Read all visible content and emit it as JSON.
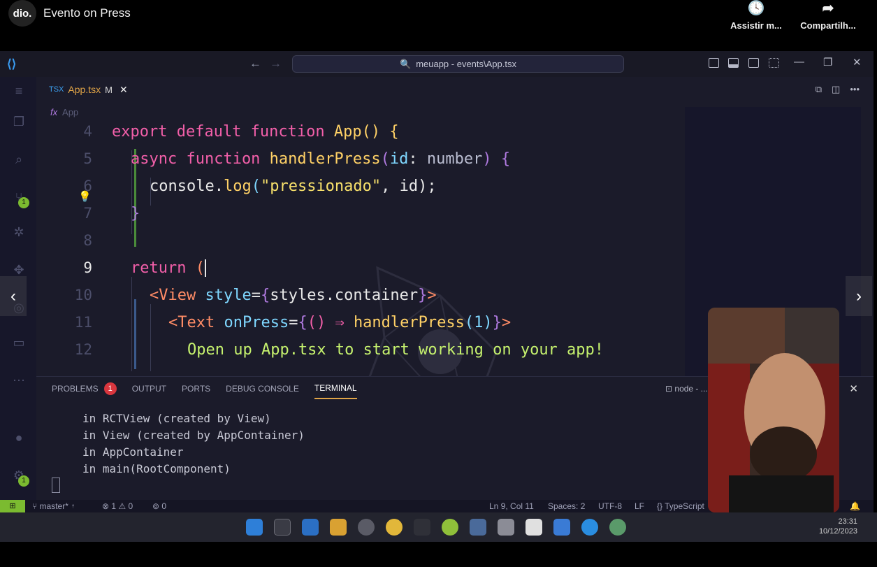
{
  "video": {
    "channel_logo": "dio.",
    "title": "Evento on Press",
    "actions": [
      {
        "icon": "clock-icon",
        "label": "Assistir m..."
      },
      {
        "icon": "share-icon",
        "label": "Compartilh..."
      }
    ]
  },
  "vscode": {
    "command_center": "meuapp - events\\App.tsx",
    "tab": {
      "type": "TSX",
      "filename": "App.tsx",
      "modified": "M"
    },
    "breadcrumb": {
      "symbol": "fx",
      "name": "App"
    },
    "editor_lines": [
      {
        "n": "4"
      },
      {
        "n": "5"
      },
      {
        "n": "6"
      },
      {
        "n": "7"
      },
      {
        "n": "8"
      },
      {
        "n": "9"
      },
      {
        "n": "10"
      },
      {
        "n": "11"
      },
      {
        "n": "12"
      }
    ],
    "code": {
      "l4_kw": "export default function",
      "l4_fn": " App",
      "l4_rest": "() {",
      "l5_kw": "async function",
      "l5_fn": " handlerPress",
      "l5_open": "(",
      "l5_param": "id",
      "l5_colon": ": ",
      "l5_type": "number",
      "l5_close": ") {",
      "l6_obj": "console",
      "l6_dot": ".",
      "l6_fn": "log",
      "l6_open": "(",
      "l6_str": "\"pressionado\"",
      "l6_rest": ", id);",
      "l7": "}",
      "l9_kw": "return",
      "l9_rest": " (",
      "l10_tag": "<View",
      "l10_attr": " style",
      "l10_eq": "=",
      "l10_brace1": "{",
      "l10_val": "styles.container",
      "l10_brace2": "}",
      "l10_end": ">",
      "l11_tag": "<Text",
      "l11_attr": " onPress",
      "l11_eq": "=",
      "l11_brace1": "{",
      "l11_arrow": "() ⇒ ",
      "l11_fn": "handlerPress",
      "l11_arg": "(1)",
      "l11_brace2": "}",
      "l11_end": ">",
      "l12_text": "Open up App.tsx to start working on your app!"
    },
    "panel": {
      "tabs": [
        "PROBLEMS",
        "OUTPUT",
        "PORTS",
        "DEBUG CONSOLE",
        "TERMINAL"
      ],
      "problems_count": "1",
      "active_tab": "TERMINAL",
      "terminal_label": "node - ...",
      "terminal_lines": [
        "in RCTView (created by View)",
        "in View (created by AppContainer)",
        "in AppContainer",
        "in main(RootComponent)"
      ]
    },
    "activity_badges": {
      "source_control": "1",
      "accounts": "1"
    },
    "status": {
      "branch": "master*",
      "errors": "1",
      "warnings": "0",
      "ports": "0",
      "position": "Ln 9, Col 11",
      "spaces": "Spaces: 2",
      "encoding": "UTF-8",
      "eol": "LF",
      "language": "TypeScript"
    }
  },
  "taskbar": {
    "time": "23:31",
    "date": "10/12/2023"
  },
  "colors": {
    "keyword": "#f25fa9",
    "function": "#ffd166",
    "string": "#f7e06b",
    "tag": "#ff8c66",
    "attr": "#7fd7ff",
    "jsx_text": "#c6f26e",
    "badge_green": "#7bbb30",
    "badge_red": "#d9363e"
  }
}
